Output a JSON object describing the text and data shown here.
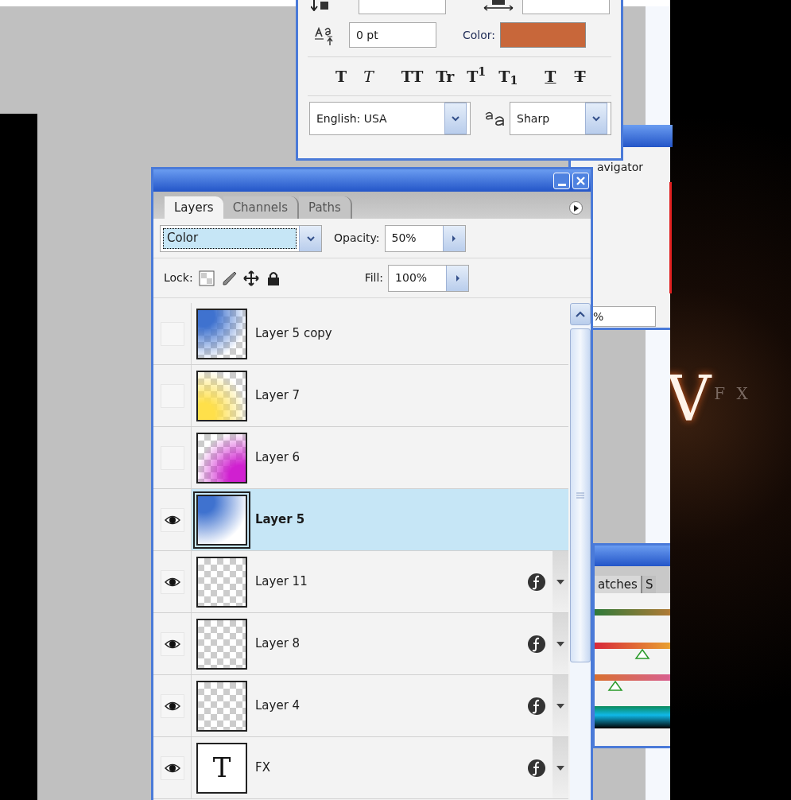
{
  "character_panel": {
    "tracking_value": "0 pt",
    "color_label": "Color:",
    "color": "#c8673a",
    "style_buttons": [
      {
        "kind": "bold",
        "label": "T"
      },
      {
        "kind": "italic",
        "label": "T"
      },
      {
        "kind": "caps",
        "label": "TT"
      },
      {
        "kind": "smallcaps",
        "label": "Tr"
      },
      {
        "kind": "super",
        "label": "T$^{1}$"
      },
      {
        "kind": "sub",
        "label": "T$_{1}$"
      },
      {
        "kind": "underline",
        "label": "T"
      },
      {
        "kind": "strike",
        "label": "T"
      }
    ],
    "language": "English: USA",
    "antialias": "Sharp"
  },
  "navigator_panel": {
    "tab": "avigator",
    "zoom_value": "%"
  },
  "swatches_panel": {
    "tabs": [
      "atches",
      "S"
    ]
  },
  "canvas": {
    "letter": "V",
    "suffix": "F X"
  },
  "layers_panel": {
    "tabs": [
      {
        "label": "Layers",
        "selected": true
      },
      {
        "label": "Channels",
        "selected": false
      },
      {
        "label": "Paths",
        "selected": false
      }
    ],
    "blend_mode": "Color",
    "opacity_label": "Opacity:",
    "opacity": "50%",
    "lock_label": "Lock:",
    "fill_label": "Fill:",
    "fill": "100%",
    "layers": [
      {
        "name": "Layer 5 copy",
        "visible": false,
        "selected": false,
        "effects": false,
        "thumb": {
          "kind": "glow-top-left",
          "color": "#3f72cf"
        }
      },
      {
        "name": "Layer 7",
        "visible": false,
        "selected": false,
        "effects": false,
        "thumb": {
          "kind": "glow-bottom-left",
          "color": "#ffe04a"
        }
      },
      {
        "name": "Layer 6",
        "visible": false,
        "selected": false,
        "effects": false,
        "thumb": {
          "kind": "glow-bottom-right",
          "color": "#d020d0"
        }
      },
      {
        "name": "Layer 5",
        "visible": true,
        "selected": true,
        "effects": false,
        "thumb": {
          "kind": "opaque-glow-top-left",
          "color": "#3f72cf"
        }
      },
      {
        "name": "Layer 11",
        "visible": true,
        "selected": false,
        "effects": true,
        "thumb": {
          "kind": "empty"
        }
      },
      {
        "name": "Layer 8",
        "visible": true,
        "selected": false,
        "effects": true,
        "thumb": {
          "kind": "empty"
        }
      },
      {
        "name": "Layer 4",
        "visible": true,
        "selected": false,
        "effects": true,
        "thumb": {
          "kind": "empty"
        }
      },
      {
        "name": "FX",
        "visible": true,
        "selected": false,
        "effects": true,
        "thumb": {
          "kind": "text",
          "glyph": "T"
        }
      }
    ]
  }
}
